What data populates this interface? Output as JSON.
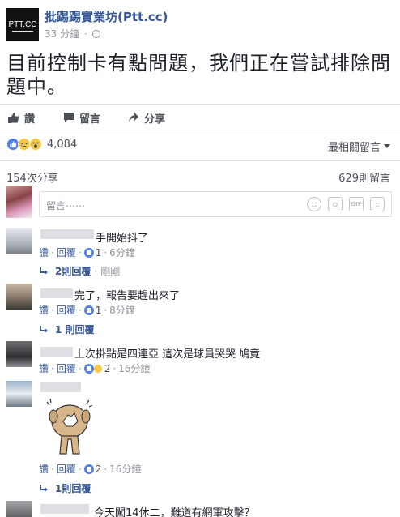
{
  "post": {
    "page_name": "批踢踢實業坊(Ptt.cc)",
    "logo_text": "PTT.CC",
    "time": "33 分鐘",
    "text": "目前控制卡有點問題，我們正在嘗試排除問題中。"
  },
  "actions": {
    "like": "讚",
    "comment": "留言",
    "share": "分享"
  },
  "reactions": {
    "count": "4,084",
    "sort_label": "最相關留言"
  },
  "stats": {
    "shares": "154次分享",
    "comments": "629則留言"
  },
  "composer": {
    "placeholder": "留言⋯⋯",
    "icons": [
      "emoji-icon",
      "camera-icon",
      "gif-icon",
      "sticker-icon"
    ],
    "gif_label": "GIF"
  },
  "comments": [
    {
      "text": "手開始抖了",
      "like_label": "讚",
      "reply_label": "回覆",
      "likes": "1",
      "time": "6分鐘",
      "replies": "2則回覆",
      "reply_time": "剛剛"
    },
    {
      "text": "完了，報告要趕出來了",
      "like_label": "讚",
      "reply_label": "回覆",
      "likes": "1",
      "time": "8分鐘",
      "replies": "1 則回覆"
    },
    {
      "text": "上次掛點是四連亞 這次是球員哭哭 鳩竟",
      "like_label": "讚",
      "reply_label": "回覆",
      "likes": "2",
      "time": "16分鐘"
    },
    {
      "text": "",
      "like_label": "讚",
      "reply_label": "回覆",
      "likes": "2",
      "time": "16分鐘",
      "replies": "1則回覆"
    },
    {
      "text": "今天闖14休二，難道有網軍攻擊？"
    }
  ],
  "colors": {
    "link": "#365899",
    "like_blue": "#4f7ff0",
    "gray": "#90949c"
  }
}
